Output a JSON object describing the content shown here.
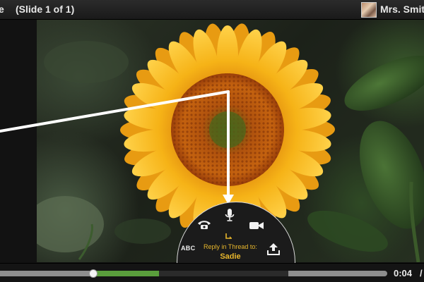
{
  "header": {
    "title": "e",
    "slide_counter": "(Slide 1 of 1)",
    "user_name": "Mrs. Smith"
  },
  "reply_wheel": {
    "caption": "Reply in Thread to:",
    "target": "Sadie",
    "text_label": "ABC",
    "actions": [
      "microphone-icon",
      "phone-icon",
      "video-camera-icon",
      "upload-icon"
    ],
    "accent_color": "#e7b62c"
  },
  "timeline": {
    "current_time": "0:04",
    "separator": "/",
    "progress": 0.24,
    "comment_segment": [
      0.24,
      0.41
    ],
    "buffered_segment": [
      0.41,
      0.745
    ],
    "comment_color": "#5a9e3c"
  },
  "colors": {
    "petal": "#f6b317",
    "petal_shadow": "#e08a0e",
    "disk": "#b1530e",
    "disk_center": "#556a1d",
    "annotation_line": "#ffffff"
  }
}
